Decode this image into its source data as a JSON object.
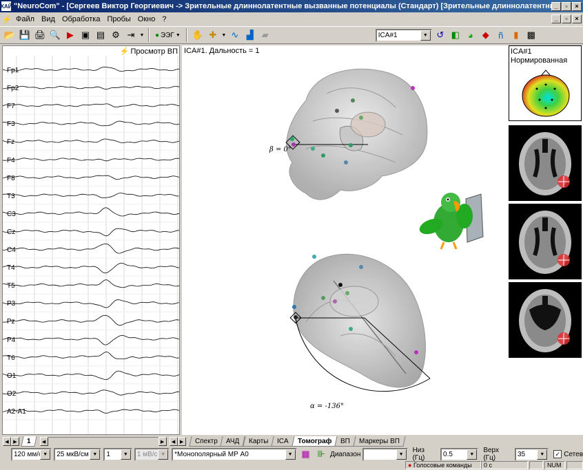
{
  "window": {
    "title": "\"NeuroCom\" - [Сергеев Виктор Георгиевич -> Зрительные длиннолатентные вызванные потенциалы (Стандарт) [Зрительные длиннолатентные ВП]]",
    "app_icon": "ХАЙ",
    "minimize": "_",
    "restore": "▫",
    "close": "×"
  },
  "menu": {
    "items": [
      "Файл",
      "Вид",
      "Обработка",
      "Пробы",
      "Окно",
      "?"
    ]
  },
  "toolbar": {
    "eeg_label": "ЭЭГ",
    "component_combo": "ICA#1"
  },
  "eeg": {
    "header": "Просмотр ВП",
    "channels": [
      "Fp1",
      "Fp2",
      "F7",
      "F3",
      "Fz",
      "F4",
      "F8",
      "T3",
      "C3",
      "Cz",
      "C4",
      "T4",
      "T5",
      "P3",
      "Pz",
      "P4",
      "T6",
      "O1",
      "O2",
      "A2-A1"
    ]
  },
  "main": {
    "title": "ICA#1. Дальность = 1",
    "beta_label": "β = 0°",
    "alpha_label": "α = -136°",
    "thumb_top_line1": "ICA#1",
    "thumb_top_line2": "Нормированная"
  },
  "tabs": {
    "page_tab": "1",
    "items": [
      "Спектр",
      "АЧД",
      "Карты",
      "ICA",
      "Томограф",
      "ВП",
      "Маркеры ВП"
    ],
    "active": "Томограф"
  },
  "controls": {
    "speed": "120 мм/с",
    "sensitivity": "25 мкВ/см",
    "factor": "1",
    "unit": "1 мВ/с",
    "montage": "*Монополярный МР А0",
    "range_label": "Диапазон",
    "range_value": "",
    "low_label": "Низ (Гц)",
    "low_value": "0.5",
    "high_label": "Верх (Гц)",
    "high_value": "35",
    "network_label": "Сетев"
  },
  "status": {
    "voice": "Голосовые команды",
    "time": "0 с",
    "num": "NUM"
  },
  "colors": {
    "title_bar": "#0a246a",
    "window_bg": "#d4d0c8",
    "eeg_trace": "#000000"
  }
}
